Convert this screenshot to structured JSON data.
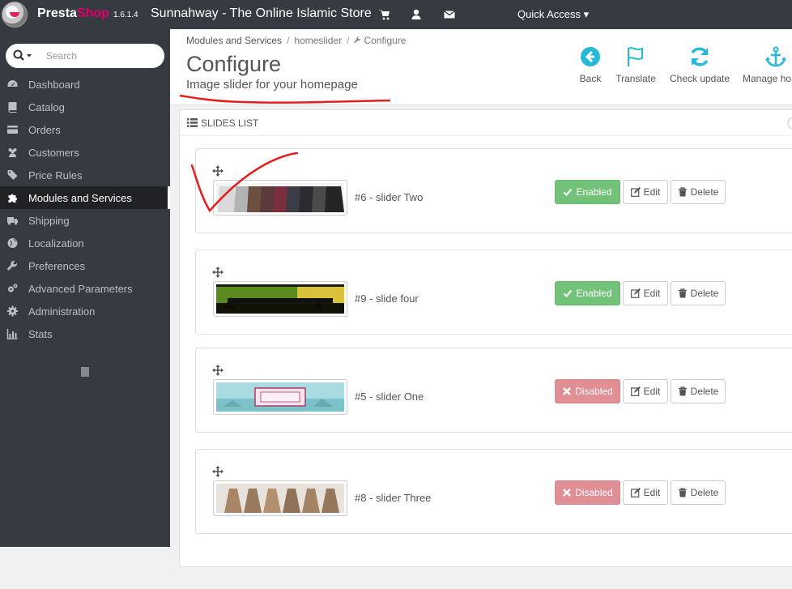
{
  "app": {
    "brand_a": "Presta",
    "brand_b": "Shop",
    "version": "1.6.1.4",
    "store_name": "Sunnahway - The Online Islamic Store",
    "quick_access": "Quick Access ▾"
  },
  "search": {
    "placeholder": "Search"
  },
  "sidebar": {
    "items": [
      {
        "label": "Dashboard",
        "icon": "dashboard-icon",
        "active": false
      },
      {
        "label": "Catalog",
        "icon": "book-icon",
        "active": false
      },
      {
        "label": "Orders",
        "icon": "credit-card-icon",
        "active": false
      },
      {
        "label": "Customers",
        "icon": "users-icon",
        "active": false
      },
      {
        "label": "Price Rules",
        "icon": "tags-icon",
        "active": false
      },
      {
        "label": "Modules and Services",
        "icon": "puzzle-icon",
        "active": true
      },
      {
        "label": "Shipping",
        "icon": "truck-icon",
        "active": false
      },
      {
        "label": "Localization",
        "icon": "globe-icon",
        "active": false
      },
      {
        "label": "Preferences",
        "icon": "wrench-icon",
        "active": false
      },
      {
        "label": "Advanced Parameters",
        "icon": "cogs-icon",
        "active": false
      },
      {
        "label": "Administration",
        "icon": "gear-icon",
        "active": false
      },
      {
        "label": "Stats",
        "icon": "bar-chart-icon",
        "active": false
      }
    ]
  },
  "breadcrumb": {
    "items": [
      "Modules and Services",
      "homeslider",
      "Configure"
    ]
  },
  "page": {
    "title": "Configure",
    "subtitle": "Image slider for your homepage"
  },
  "toolbar": {
    "back": "Back",
    "translate": "Translate",
    "check_update": "Check update",
    "manage_hooks": "Manage ho"
  },
  "panel": {
    "title": "SLIDES LIST"
  },
  "slides": [
    {
      "title": "#6 - slider Two",
      "status": "Enabled",
      "edit": "Edit",
      "delete": "Delete"
    },
    {
      "title": "#9 - slide four",
      "status": "Enabled",
      "edit": "Edit",
      "delete": "Delete"
    },
    {
      "title": "#5 - slider One",
      "status": "Disabled",
      "edit": "Edit",
      "delete": "Delete"
    },
    {
      "title": "#8 - slider Three",
      "status": "Disabled",
      "edit": "Edit",
      "delete": "Delete"
    }
  ],
  "colors": {
    "topbar": "#363a41",
    "accent": "#25b9d7",
    "enabled": "#72c279",
    "disabled": "#e08f95",
    "annotation": "#e41e1e"
  }
}
